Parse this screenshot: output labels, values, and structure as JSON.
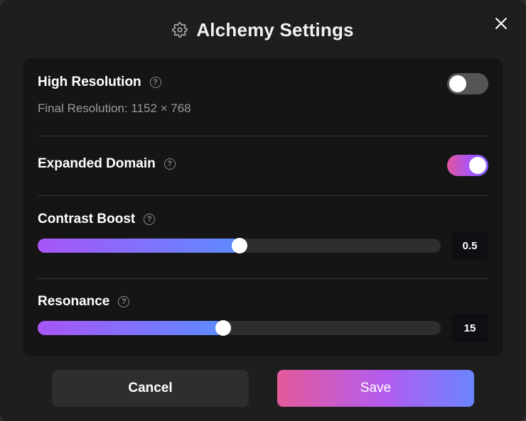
{
  "dialog": {
    "title": "Alchemy Settings",
    "header_icon": "gear-icon",
    "close_icon": "close-icon"
  },
  "settings": {
    "high_resolution": {
      "label": "High Resolution",
      "help_icon": "help-icon",
      "enabled": false,
      "sub_text": "Final Resolution: 1152 × 768"
    },
    "expanded_domain": {
      "label": "Expanded Domain",
      "help_icon": "help-icon",
      "enabled": true
    },
    "contrast_boost": {
      "label": "Contrast Boost",
      "help_icon": "help-icon",
      "value": "0.5",
      "fraction": 0.5
    },
    "resonance": {
      "label": "Resonance",
      "help_icon": "help-icon",
      "value": "15",
      "fraction": 0.46
    }
  },
  "buttons": {
    "cancel": "Cancel",
    "save": "Save"
  },
  "colors": {
    "accent_start": "#a855f7",
    "accent_end": "#5d8bff",
    "toggle_on_start": "#e2559c",
    "save_start": "#e45a9a",
    "save_end": "#6a85ff",
    "panel_bg": "#151515",
    "dialog_bg": "#1e1e1e"
  }
}
